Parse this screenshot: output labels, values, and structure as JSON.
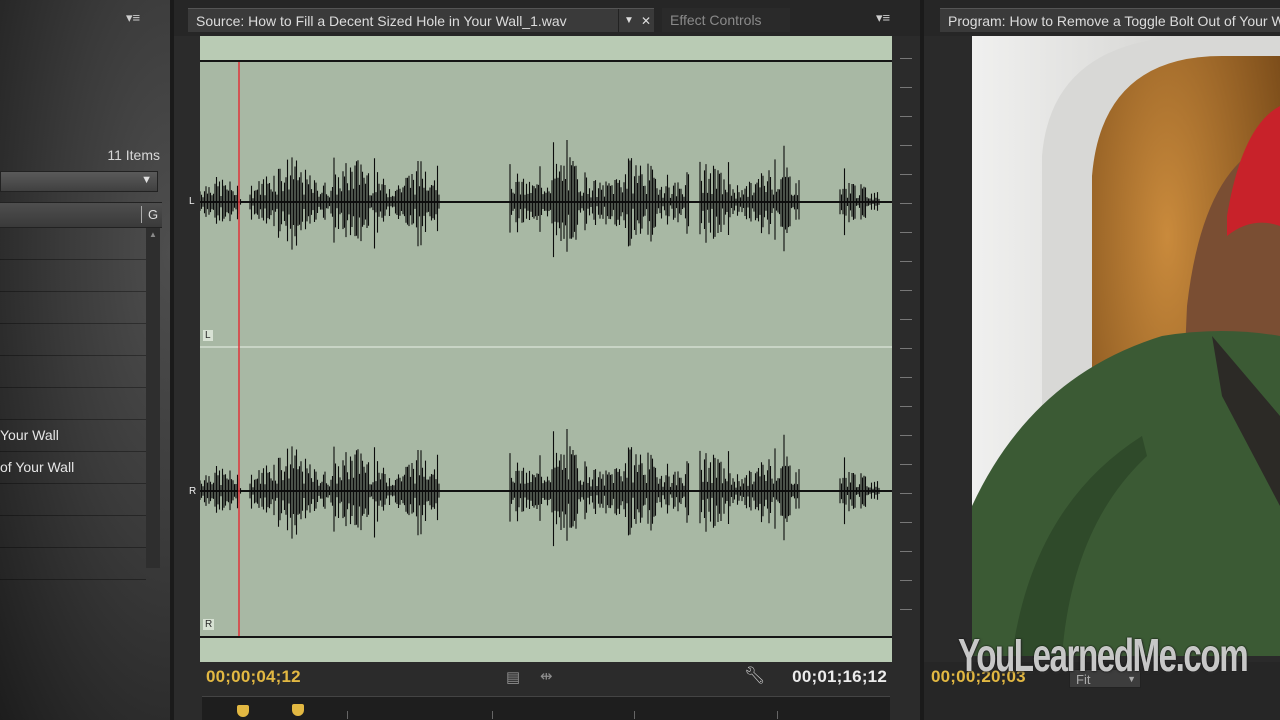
{
  "colors": {
    "accent_timecode": "#e2b842",
    "waveform_bg": "#a8b8a4",
    "playhead": "#e0323a"
  },
  "project": {
    "item_count": "11 Items",
    "column_header_partial": "G",
    "rows": [
      "",
      "",
      "",
      "",
      "",
      "",
      "Your Wall",
      "of Your Wall",
      "",
      "",
      ""
    ]
  },
  "source_monitor": {
    "tab_title": "Source: How to Fill a Decent Sized Hole in Your Wall_1.wav",
    "effect_controls_tab": "Effect Controls",
    "channel_left": "L",
    "channel_right": "R",
    "timecode_in": "00;00;04;12",
    "timecode_duration": "00;01;16;12",
    "icons": [
      "panel-menu-icon",
      "dropdown-caret-icon",
      "close-icon",
      "drag-video-icon",
      "drag-audio-icon",
      "wrench-icon"
    ]
  },
  "program_monitor": {
    "tab_title": "Program: How to Remove a Toggle Bolt Out of Your Wall",
    "timecode": "00;00;20;03",
    "zoom_select": "Fit"
  },
  "watermark": "YouLearnedMe.com"
}
